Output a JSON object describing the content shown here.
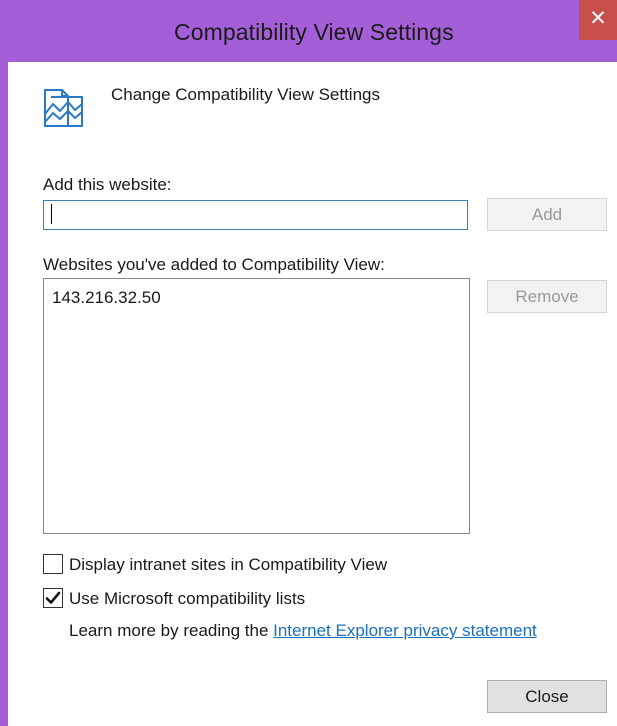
{
  "window": {
    "title": "Compatibility View Settings",
    "close_glyph": "✕"
  },
  "header": {
    "icon": "compatibility-view-icon",
    "text": "Change Compatibility View Settings"
  },
  "add_section": {
    "label": "Add this website:",
    "input_value": "",
    "input_placeholder": "",
    "add_button_label": "Add"
  },
  "websites_section": {
    "label": "Websites you've added to Compatibility View:",
    "items": [
      "143.216.32.50"
    ],
    "remove_button_label": "Remove"
  },
  "options": {
    "intranet": {
      "label": "Display intranet sites in Compatibility View",
      "checked": false
    },
    "microsoft_lists": {
      "label": "Use Microsoft compatibility lists",
      "checked": true
    }
  },
  "learn_more": {
    "prefix": "Learn more by reading the ",
    "link_text": "Internet Explorer privacy statement"
  },
  "footer": {
    "close_button_label": "Close"
  },
  "colors": {
    "frame": "#a45fd8",
    "close_button": "#c7504a",
    "link": "#1a6fbf",
    "icon": "#2a78c8"
  }
}
